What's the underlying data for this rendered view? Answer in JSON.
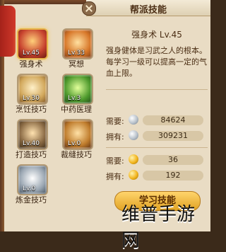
{
  "window": {
    "title": "帮派技能"
  },
  "skills": [
    {
      "name": "强身术",
      "level": "Lv.45",
      "icon": "fist-icon",
      "color": "#c7422e"
    },
    {
      "name": "冥想",
      "level": "Lv.33",
      "icon": "meditation-icon",
      "color": "#d8782a"
    },
    {
      "name": "烹饪技巧",
      "level": "Lv.30",
      "icon": "cooking-icon",
      "color": "#d2a85c"
    },
    {
      "name": "中药医理",
      "level": "Lv.3",
      "icon": "herb-icon",
      "color": "#4e9a2d"
    },
    {
      "name": "打造技巧",
      "level": "Lv.40",
      "icon": "forge-icon",
      "color": "#8b6b45"
    },
    {
      "name": "裁缝技巧",
      "level": "Lv.0",
      "icon": "tailor-icon",
      "color": "#c07d2d"
    },
    {
      "name": "炼金技巧",
      "level": "Lv.0",
      "icon": "alchemy-icon",
      "color": "#9aa6b2"
    }
  ],
  "detail": {
    "skill_title": "强身术 Lv.45",
    "description": "强身健体是习武之人的根本。每学习一级可以提高一定的气血上限。",
    "cost": [
      {
        "label": "需要:",
        "value": "84624",
        "coin": "silver-coin-icon"
      },
      {
        "label": "拥有:",
        "value": "309231",
        "coin": "silver-coin-icon"
      },
      {
        "label": "需要:",
        "value": "36",
        "coin": "gold-coin-icon"
      },
      {
        "label": "拥有:",
        "value": "192",
        "coin": "gold-coin-icon"
      }
    ],
    "learn_button": "学习技能"
  },
  "watermark": "维普手游网",
  "colors": {
    "silver": "#b9c2cb",
    "gold": "#f2b51f"
  }
}
